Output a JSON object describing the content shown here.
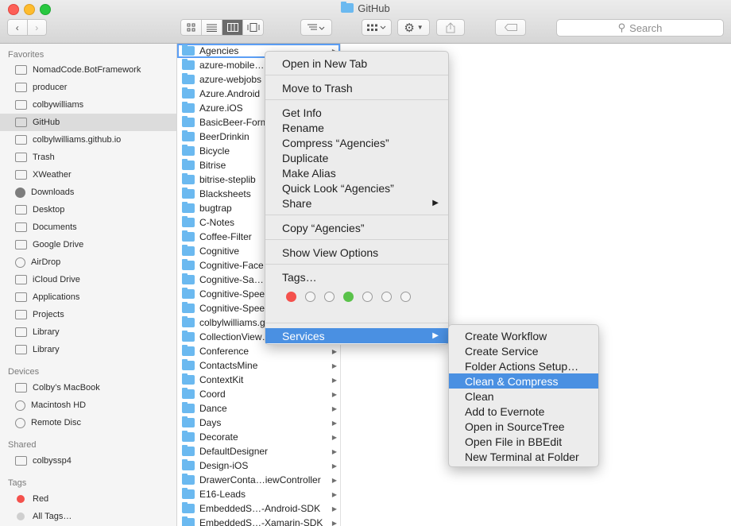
{
  "window": {
    "title": "GitHub"
  },
  "toolbar": {
    "back_icon": "chevron-left-icon",
    "forward_icon": "chevron-right-icon",
    "view_modes": [
      "icon-view",
      "list-view",
      "column-view",
      "cover-flow-view"
    ],
    "search_placeholder": "Search"
  },
  "sidebar": {
    "favorites_label": "Favorites",
    "favorites": [
      {
        "label": "NomadCode.BotFramework",
        "icon": "folder-icon"
      },
      {
        "label": "producer",
        "icon": "folder-icon"
      },
      {
        "label": "colbywilliams",
        "icon": "home-icon"
      },
      {
        "label": "GitHub",
        "icon": "folder-icon",
        "selected": true
      },
      {
        "label": "colbylwilliams.github.io",
        "icon": "folder-icon"
      },
      {
        "label": "Trash",
        "icon": "folder-icon"
      },
      {
        "label": "XWeather",
        "icon": "folder-icon"
      },
      {
        "label": "Downloads",
        "icon": "download-icon"
      },
      {
        "label": "Desktop",
        "icon": "desktop-icon"
      },
      {
        "label": "Documents",
        "icon": "document-icon"
      },
      {
        "label": "Google Drive",
        "icon": "folder-icon"
      },
      {
        "label": "AirDrop",
        "icon": "airdrop-icon"
      },
      {
        "label": "iCloud Drive",
        "icon": "cloud-icon"
      },
      {
        "label": "Applications",
        "icon": "applications-icon"
      },
      {
        "label": "Projects",
        "icon": "folder-icon"
      },
      {
        "label": "Library",
        "icon": "folder-icon"
      },
      {
        "label": "Library",
        "icon": "folder-icon"
      }
    ],
    "devices_label": "Devices",
    "devices": [
      {
        "label": "Colby’s MacBook",
        "icon": "laptop-icon"
      },
      {
        "label": "Macintosh HD",
        "icon": "disk-icon"
      },
      {
        "label": "Remote Disc",
        "icon": "disc-icon"
      }
    ],
    "shared_label": "Shared",
    "shared": [
      {
        "label": "colbyssp4",
        "icon": "computer-icon"
      }
    ],
    "tags_label": "Tags",
    "tags": [
      {
        "label": "Red",
        "color": "#f4514c"
      },
      {
        "label": "All Tags…",
        "color": "#cfcfcf"
      }
    ]
  },
  "column": {
    "items": [
      "Agencies",
      "azure-mobile…",
      "azure-webjobs",
      "Azure.Android",
      "Azure.iOS",
      "BasicBeer-Forms",
      "BeerDrinkin",
      "Bicycle",
      "Bitrise",
      "bitrise-steplib",
      "Blacksheets",
      "bugtrap",
      "C-Notes",
      "Coffee-Filter",
      "Cognitive",
      "Cognitive-Face",
      "Cognitive-Sa…",
      "Cognitive-Spee…",
      "Cognitive-Spee…",
      "colbylwilliams.github.io",
      "CollectionView…",
      "Conference",
      "ContactsMine",
      "ContextKit",
      "Coord",
      "Dance",
      "Days",
      "Decorate",
      "DefaultDesigner",
      "Design-iOS",
      "DrawerConta…iewController",
      "E16-Leads",
      "EmbeddedS…-Android-SDK",
      "EmbeddedS…-Xamarin-SDK"
    ],
    "selected": "Agencies"
  },
  "context_menu": {
    "groups": [
      [
        "Open in New Tab"
      ],
      [
        "Move to Trash"
      ],
      [
        "Get Info",
        "Rename",
        "Compress “Agencies”",
        "Duplicate",
        "Make Alias",
        "Quick Look “Agencies”",
        "Share"
      ],
      [
        "Copy “Agencies”"
      ],
      [
        "Show View Options"
      ],
      [
        "Tags…"
      ],
      [
        "Services"
      ]
    ],
    "tag_colors": [
      "#f4514c",
      null,
      null,
      "#5ac24a",
      null,
      null,
      null
    ],
    "highlighted": "Services"
  },
  "services_menu": {
    "items": [
      "Create Workflow",
      "Create Service",
      "Folder Actions Setup…",
      "Clean & Compress",
      "Clean",
      "Add to Evernote",
      "Open in SourceTree",
      "Open File in BBEdit",
      "New Terminal at Folder"
    ],
    "highlighted": "Clean & Compress"
  }
}
